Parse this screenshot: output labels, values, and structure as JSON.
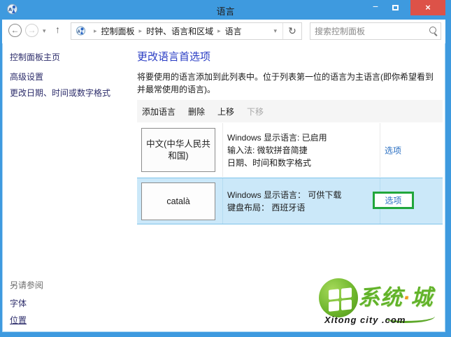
{
  "window": {
    "title": "语言",
    "controls": {
      "minimize": "−",
      "close": "×"
    }
  },
  "address_bar": {
    "back": "←",
    "forward": "→",
    "chevron": "▾",
    "up_arrow": "↑",
    "breadcrumb": [
      "控制面板",
      "时钟、语言和区域",
      "语言"
    ],
    "breadcrumb_separator": "▸",
    "refresh": "↻",
    "search_placeholder": "搜索控制面板"
  },
  "sidebar": {
    "home": "控制面板主页",
    "items": [
      "高级设置",
      "更改日期、时间或数字格式"
    ],
    "see_also": {
      "header": "另请参阅",
      "items": [
        "字体",
        "位置"
      ]
    }
  },
  "main": {
    "title": "更改语言首选项",
    "description": "将要使用的语言添加到此列表中。位于列表第一位的语言为主语言(即你希望看到并最常使用的语言)。",
    "toolbar": {
      "add": "添加语言",
      "remove": "删除",
      "move_up": "上移",
      "move_down": "下移"
    },
    "languages": [
      {
        "badge": "中文(中华人民共和国)",
        "details": [
          "Windows 显示语言: 已启用",
          "输入法: 微软拼音简捷",
          "日期、时间和数字格式"
        ],
        "options_label": "选项",
        "selected": false,
        "highlighted": false
      },
      {
        "badge": "català",
        "details": [
          "Windows 显示语言： 可供下载",
          "键盘布局： 西班牙语"
        ],
        "options_label": "选项",
        "selected": true,
        "highlighted": true
      }
    ]
  },
  "watermark": {
    "brand_part1": "系统",
    "brand_dot": "·",
    "brand_part2": "城",
    "site": "Xitong city .com"
  },
  "colors": {
    "titlebar_blue": "#3e9adf",
    "close_red": "#dd5248",
    "heading_blue": "#2a3dc4",
    "link_blue": "#2a6fc2",
    "sidebar_navy": "#2d2d6b",
    "selection_bg": "#cbe8f9",
    "selection_border": "#7fc3ea",
    "annotation_green": "#21a63c",
    "toolbar_bg": "#f5f5f5",
    "brand_green": "#62b32a",
    "brand_orange": "#f09a1e"
  }
}
